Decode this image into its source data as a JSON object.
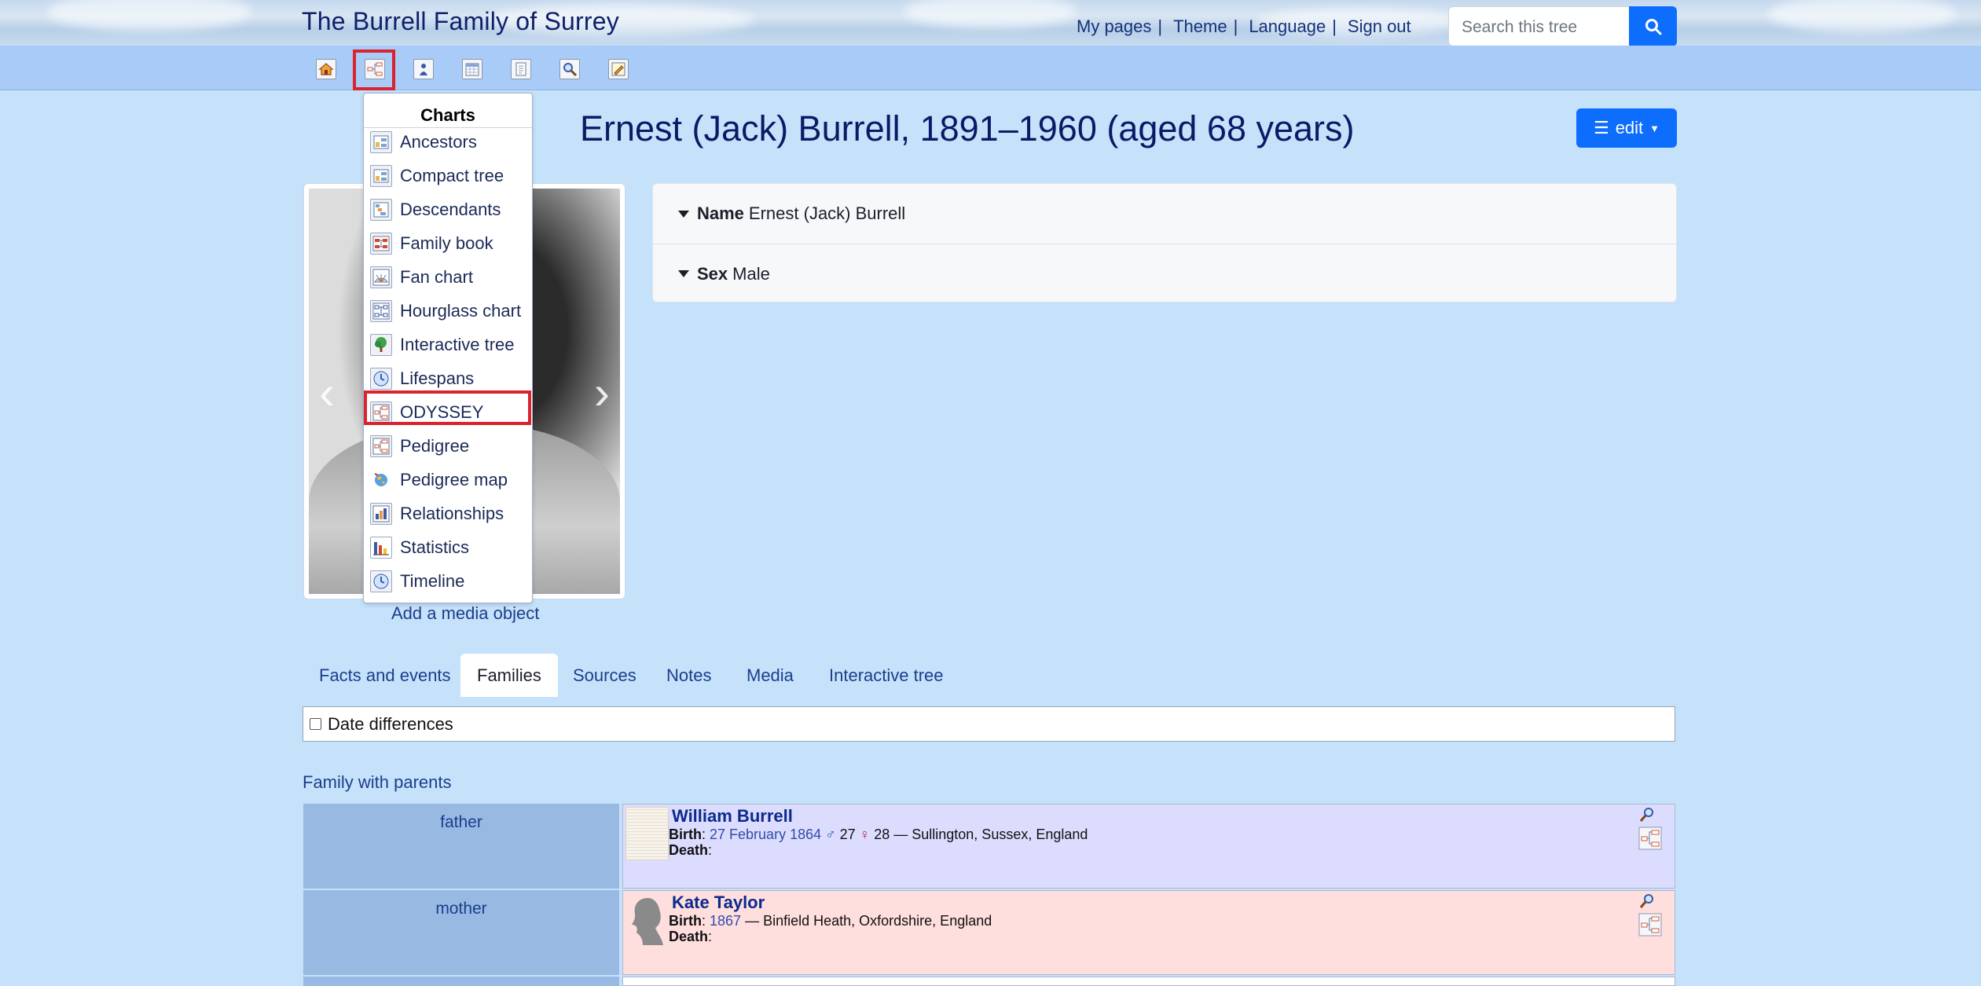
{
  "header": {
    "site_title": "The Burrell Family of Surrey",
    "links": [
      "My pages",
      "Theme",
      "Language",
      "Sign out"
    ],
    "search_placeholder": "Search this tree"
  },
  "menubar": {
    "icons": [
      "home-icon",
      "charts-icon",
      "lists-icon",
      "calendar-icon",
      "reports-icon",
      "search-icon",
      "edit-icon"
    ]
  },
  "charts_menu": {
    "header": "Charts",
    "items": [
      "Ancestors",
      "Compact tree",
      "Descendants",
      "Family book",
      "Fan chart",
      "Hourglass chart",
      "Interactive tree",
      "Lifespans",
      "ODYSSEY",
      "Pedigree",
      "Pedigree map",
      "Relationships",
      "Statistics",
      "Timeline"
    ],
    "highlighted": "ODYSSEY"
  },
  "page": {
    "title": "Ernest (Jack) Burrell, 1891–1960 (aged 68 years)",
    "edit_label": "edit",
    "add_media": "Add a media object"
  },
  "facts": {
    "name_label": "Name",
    "name_value": "Ernest (Jack) Burrell",
    "sex_label": "Sex",
    "sex_value": "Male"
  },
  "tabs": [
    "Facts and events",
    "Families",
    "Sources",
    "Notes",
    "Media",
    "Interactive tree"
  ],
  "active_tab": "Families",
  "date_differences_label": "Date differences",
  "family_heading": "Family with parents",
  "family": [
    {
      "role": "father",
      "name": "William Burrell",
      "birth_label": "Birth",
      "birth_date": "27 February 1864",
      "father_age": "27",
      "mother_age": "28",
      "birth_place": "— Sullington, Sussex, England",
      "death_label": "Death",
      "sex": "male"
    },
    {
      "role": "mother",
      "name": "Kate Taylor",
      "birth_label": "Birth",
      "birth_date": "1867",
      "birth_place": "— Binfield Heath, Oxfordshire, England",
      "death_label": "Death",
      "sex": "female"
    }
  ],
  "colors": {
    "page_bg": "#c6e2fb",
    "menubar_bg": "#a9cbf7",
    "primary_button": "#0d6efd",
    "highlight": "#d9232e",
    "male_row": "#dcdcff",
    "female_row": "#ffdede",
    "role_cell": "#97b9e2"
  }
}
